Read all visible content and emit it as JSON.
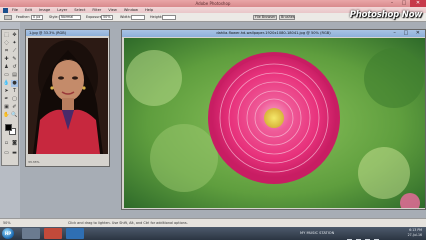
{
  "titlebar": {
    "title": "Adobe Photoshop"
  },
  "menu": [
    "File",
    "Edit",
    "Image",
    "Layer",
    "Select",
    "Filter",
    "View",
    "Window",
    "Help"
  ],
  "options": {
    "feather_label": "Feather:",
    "feather_value": "0 px",
    "style_label": "Style:",
    "style_value": "Normal",
    "width_label": "Width:",
    "height_label": "Height:",
    "exposure_label": "Exposure:",
    "exposure_value": "50%",
    "file_browser_label": "File Browser",
    "brushes_label": "Brushes"
  },
  "brand": "Photoshop Now",
  "doc1": {
    "title": "1.jpg @ 33.3% (RGB)",
    "zoom": "33.33%"
  },
  "doc2": {
    "title": "dahlia-flower-hd-wallpaper-1920x1080-18041.jpg @ 50% (RGB)"
  },
  "status": {
    "zoom": "50%",
    "hint": "Click and drag to lighten. Use Shift, Alt, and Ctrl for additional options."
  },
  "taskbar": {
    "start_label": "HP",
    "station": "MY MUSIC STATION",
    "time": "6:13 PM",
    "date": "27-Jul-16"
  },
  "colors": {
    "titlebar": "#e09a9c",
    "flower": "#e8327c",
    "background": "#6aa84a"
  }
}
